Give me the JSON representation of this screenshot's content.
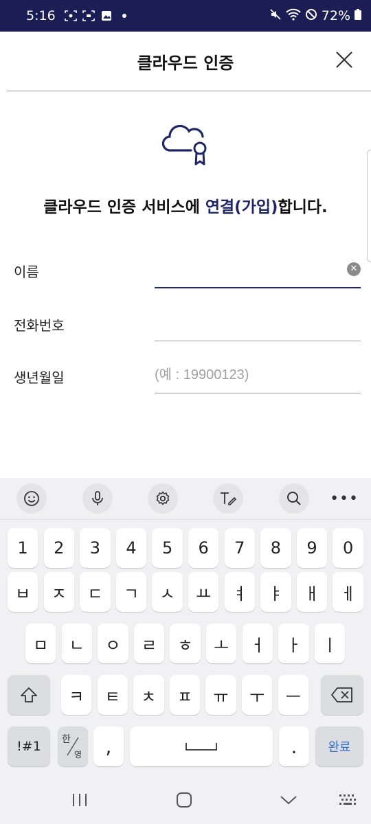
{
  "status_bar": {
    "time": "5:16",
    "battery": "72%",
    "left_icons": [
      "screen-record-icon",
      "screenshot-icon",
      "gallery-icon",
      "dot-icon"
    ],
    "right_icons": [
      "mute-icon",
      "wifi-icon",
      "do-not-disturb-icon",
      "battery-icon"
    ]
  },
  "header": {
    "title": "클라우드 인증"
  },
  "headline": {
    "part1": "클라우드 인증 서비스에 ",
    "accent": "연결(가입)",
    "part2": "합니다."
  },
  "form": {
    "name": {
      "label": "이름",
      "value": "",
      "placeholder": ""
    },
    "phone": {
      "label": "전화번호",
      "value": "",
      "placeholder": ""
    },
    "birth": {
      "label": "생년월일",
      "value": "",
      "placeholder": "(예 : 19900123)"
    }
  },
  "keyboard": {
    "toolbar": [
      "emoji-icon",
      "mic-icon",
      "settings-icon",
      "handwriting-icon",
      "search-icon",
      "more-icon"
    ],
    "more_label": "•••",
    "row_numbers": [
      "1",
      "2",
      "3",
      "4",
      "5",
      "6",
      "7",
      "8",
      "9",
      "0"
    ],
    "row1": [
      "ㅂ",
      "ㅈ",
      "ㄷ",
      "ㄱ",
      "ㅅ",
      "ㅛ",
      "ㅕ",
      "ㅑ",
      "ㅐ",
      "ㅔ"
    ],
    "row2": [
      "ㅁ",
      "ㄴ",
      "ㅇ",
      "ㄹ",
      "ㅎ",
      "ㅗ",
      "ㅓ",
      "ㅏ",
      "ㅣ"
    ],
    "row3": [
      "ㅋ",
      "ㅌ",
      "ㅊ",
      "ㅍ",
      "ㅠ",
      "ㅜ",
      "ㅡ"
    ],
    "symbols_label": "!#1",
    "lang_top": "한",
    "lang_bottom": "영",
    "comma_label": ",",
    "period_label": ".",
    "done_label": "완료"
  },
  "colors": {
    "status_bar": "#1a1e55",
    "accent": "#1f2668",
    "done_key": "#2f6fd0"
  }
}
